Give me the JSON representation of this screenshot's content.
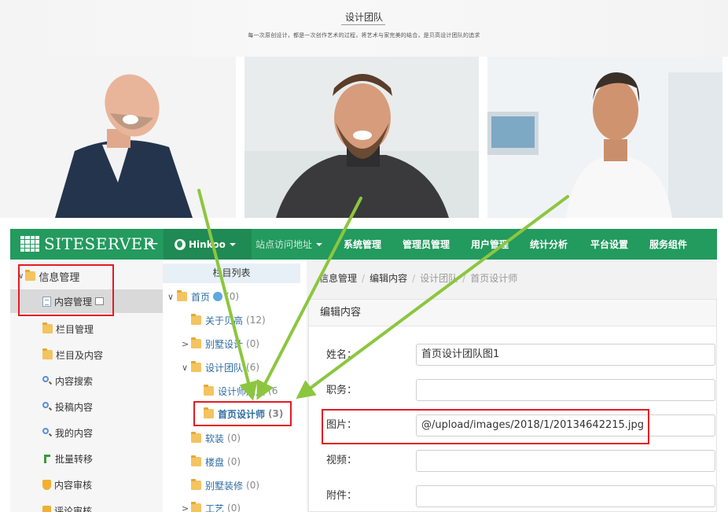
{
  "banner": {
    "title": "设计团队",
    "subtitle": "每一次原创设计，都是一次创作艺术的过程，将艺术与家完美的结合，是贝高设计团队的追求"
  },
  "topbar": {
    "logo": "SITESERVER",
    "site_menu": "Hinkoo",
    "nav": [
      "站点访问地址",
      "系统管理",
      "管理员管理",
      "用户管理",
      "统计分析",
      "平台设置",
      "服务组件"
    ]
  },
  "sidebar": {
    "header": "信息管理",
    "items": [
      {
        "label": "内容管理",
        "icon": "page-icon"
      },
      {
        "label": "栏目管理",
        "icon": "folder-icon"
      },
      {
        "label": "栏目及内容",
        "icon": "folder-icon"
      },
      {
        "label": "内容搜索",
        "icon": "search-icon"
      },
      {
        "label": "投稿内容",
        "icon": "search-icon"
      },
      {
        "label": "我的内容",
        "icon": "search-icon"
      },
      {
        "label": "批量转移",
        "icon": "move-icon"
      },
      {
        "label": "内容审核",
        "icon": "shield-icon"
      },
      {
        "label": "评论审核",
        "icon": "shield-icon"
      }
    ]
  },
  "tree": {
    "header": "栏目列表",
    "nodes": [
      {
        "label": "首页",
        "count": "(0)",
        "toggle": "∨"
      },
      {
        "label": "关于贝高",
        "count": "(12)",
        "toggle": ""
      },
      {
        "label": "别墅设计",
        "count": "(0)",
        "toggle": ">"
      },
      {
        "label": "设计团队",
        "count": "(6)",
        "toggle": "∨"
      },
      {
        "label": "设计师加入",
        "count": "(6",
        "toggle": ""
      },
      {
        "label": "首页设计师",
        "count": "(3)",
        "toggle": ""
      },
      {
        "label": "软装",
        "count": "(0)",
        "toggle": ""
      },
      {
        "label": "楼盘",
        "count": "(0)",
        "toggle": ""
      },
      {
        "label": "别墅装修",
        "count": "(0)",
        "toggle": ""
      },
      {
        "label": "工艺",
        "count": "(0)",
        "toggle": ">"
      }
    ]
  },
  "main": {
    "breadcrumb": [
      "信息管理",
      "编辑内容",
      "设计团队",
      "首页设计师"
    ],
    "card_title": "编辑内容",
    "fields": [
      {
        "label": "姓名：",
        "value": ""
      },
      {
        "label": "职务：",
        "value": ""
      },
      {
        "label": "图片：",
        "value": "@/upload/images/2018/1/20134642215.jpg"
      },
      {
        "label": "视频：",
        "value": ""
      },
      {
        "label": "附件：",
        "value": ""
      }
    ],
    "name_value": "首页设计团队图1"
  },
  "colors": {
    "topbar": "#239a5e",
    "highlight": "#e31b23",
    "arrow": "#8cc63f",
    "link": "#2e6da4"
  }
}
